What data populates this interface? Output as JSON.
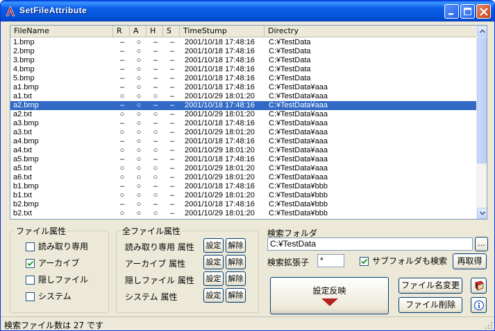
{
  "window": {
    "title": "SetFileAttribute"
  },
  "list": {
    "columns": [
      "FileName",
      "R",
      "A",
      "H",
      "S",
      "TimeStump",
      "Directry"
    ],
    "selected_index": 7,
    "rows": [
      {
        "name": "1.bmp",
        "r": "–",
        "a": "○",
        "h": "–",
        "s": "–",
        "time": "2001/10/18 17:48:16",
        "dir": "C:¥TestData"
      },
      {
        "name": "2.bmp",
        "r": "–",
        "a": "○",
        "h": "–",
        "s": "–",
        "time": "2001/10/18 17:48:16",
        "dir": "C:¥TestData"
      },
      {
        "name": "3.bmp",
        "r": "–",
        "a": "○",
        "h": "–",
        "s": "–",
        "time": "2001/10/18 17:48:16",
        "dir": "C:¥TestData"
      },
      {
        "name": "4.bmp",
        "r": "–",
        "a": "○",
        "h": "–",
        "s": "–",
        "time": "2001/10/18 17:48:16",
        "dir": "C:¥TestData"
      },
      {
        "name": "5.bmp",
        "r": "–",
        "a": "○",
        "h": "–",
        "s": "–",
        "time": "2001/10/18 17:48:16",
        "dir": "C:¥TestData"
      },
      {
        "name": "a1.bmp",
        "r": "–",
        "a": "○",
        "h": "–",
        "s": "–",
        "time": "2001/10/18 17:48:16",
        "dir": "C:¥TestData¥aaa"
      },
      {
        "name": "a1.txt",
        "r": "○",
        "a": "○",
        "h": "○",
        "s": "–",
        "time": "2001/10/29 18:01:20",
        "dir": "C:¥TestData¥aaa"
      },
      {
        "name": "a2.bmp",
        "r": "–",
        "a": "○",
        "h": "–",
        "s": "–",
        "time": "2001/10/18 17:48:16",
        "dir": "C:¥TestData¥aaa"
      },
      {
        "name": "a2.txt",
        "r": "○",
        "a": "○",
        "h": "○",
        "s": "–",
        "time": "2001/10/29 18:01:20",
        "dir": "C:¥TestData¥aaa"
      },
      {
        "name": "a3.bmp",
        "r": "–",
        "a": "○",
        "h": "–",
        "s": "–",
        "time": "2001/10/18 17:48:16",
        "dir": "C:¥TestData¥aaa"
      },
      {
        "name": "a3.txt",
        "r": "○",
        "a": "○",
        "h": "○",
        "s": "–",
        "time": "2001/10/29 18:01:20",
        "dir": "C:¥TestData¥aaa"
      },
      {
        "name": "a4.bmp",
        "r": "–",
        "a": "○",
        "h": "–",
        "s": "–",
        "time": "2001/10/18 17:48:16",
        "dir": "C:¥TestData¥aaa"
      },
      {
        "name": "a4.txt",
        "r": "○",
        "a": "○",
        "h": "○",
        "s": "–",
        "time": "2001/10/29 18:01:20",
        "dir": "C:¥TestData¥aaa"
      },
      {
        "name": "a5.bmp",
        "r": "–",
        "a": "○",
        "h": "–",
        "s": "–",
        "time": "2001/10/18 17:48:16",
        "dir": "C:¥TestData¥aaa"
      },
      {
        "name": "a5.txt",
        "r": "○",
        "a": "○",
        "h": "○",
        "s": "–",
        "time": "2001/10/29 18:01:20",
        "dir": "C:¥TestData¥aaa"
      },
      {
        "name": "a6.txt",
        "r": "○",
        "a": "○",
        "h": "○",
        "s": "–",
        "time": "2001/10/29 18:01:20",
        "dir": "C:¥TestData¥aaa"
      },
      {
        "name": "b1.bmp",
        "r": "–",
        "a": "○",
        "h": "–",
        "s": "–",
        "time": "2001/10/18 17:48:16",
        "dir": "C:¥TestData¥bbb"
      },
      {
        "name": "b1.txt",
        "r": "○",
        "a": "○",
        "h": "○",
        "s": "–",
        "time": "2001/10/29 18:01:20",
        "dir": "C:¥TestData¥bbb"
      },
      {
        "name": "b2.bmp",
        "r": "–",
        "a": "○",
        "h": "–",
        "s": "–",
        "time": "2001/10/18 17:48:16",
        "dir": "C:¥TestData¥bbb"
      },
      {
        "name": "b2.txt",
        "r": "○",
        "a": "○",
        "h": "○",
        "s": "–",
        "time": "2001/10/29 18:01:20",
        "dir": "C:¥TestData¥bbb"
      }
    ]
  },
  "file_attr": {
    "legend": "ファイル属性",
    "items": [
      {
        "label": "読み取り専用",
        "checked": false
      },
      {
        "label": "アーカイブ",
        "checked": true
      },
      {
        "label": "隠しファイル",
        "checked": false
      },
      {
        "label": "システム",
        "checked": false
      }
    ]
  },
  "all_attr": {
    "legend": "全ファイル属性",
    "rows": [
      {
        "label": "読み取り専用 属性",
        "set": "設定",
        "clear": "解除"
      },
      {
        "label": "アーカイブ 属性",
        "set": "設定",
        "clear": "解除"
      },
      {
        "label": "隠しファイル 属性",
        "set": "設定",
        "clear": "解除"
      },
      {
        "label": "システム 属性",
        "set": "設定",
        "clear": "解除"
      }
    ]
  },
  "search": {
    "folder_label": "検索フォルダ",
    "folder_value": "C:¥TestData",
    "browse_label": "...",
    "ext_label": "検索拡張子",
    "ext_value": "*",
    "subfolder_label": "サブフォルダも検索",
    "subfolder_checked": true,
    "refresh_label": "再取得"
  },
  "actions": {
    "apply_label": "設定反映",
    "rename_label": "ファイル名変更",
    "delete_label": "ファイル削除"
  },
  "status": {
    "text": "検索ファイル数は 27 です"
  },
  "colors": {
    "selection": "#316ac5",
    "apply_arrow": "#b22222"
  }
}
